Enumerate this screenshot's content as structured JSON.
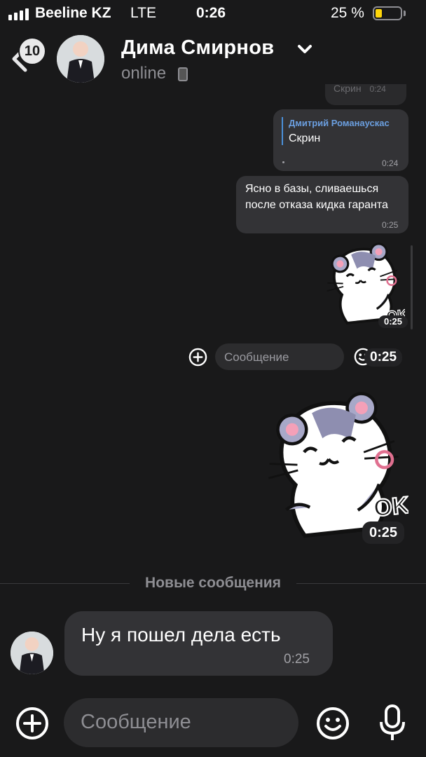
{
  "status_bar": {
    "carrier": "Beeline KZ",
    "network": "LTE",
    "time": "0:26",
    "battery": "25 %",
    "battery_level": 0.25
  },
  "header": {
    "unread_count": "10",
    "contact_name": "Дима Смирнов",
    "contact_status": "online"
  },
  "messages": {
    "ghost_text": "Скрин",
    "ghost_time": "0:24",
    "reply": {
      "author": "Дмитрий Романаускас",
      "quoted_text": "Скрин",
      "time": "0:24"
    },
    "outgoing_text": {
      "text": "Ясно в базы, сливаешься после отказа кидка гаранта",
      "time": "0:25"
    },
    "sticker_small_time": "0:25",
    "inline_input_placeholder": "Сообщение",
    "inline_overlay_time": "0:25",
    "sticker_large_time": "0:25",
    "sticker_caption": "OK",
    "new_messages_label": "Новые сообщения",
    "incoming": {
      "text": "Ну я пошел дела есть",
      "time": "0:25"
    }
  },
  "composer": {
    "placeholder": "Сообщение"
  },
  "colors": {
    "background": "#19191a",
    "bubble": "#333336",
    "reply_accent": "#6b9fe0",
    "battery": "#ffd60a"
  }
}
